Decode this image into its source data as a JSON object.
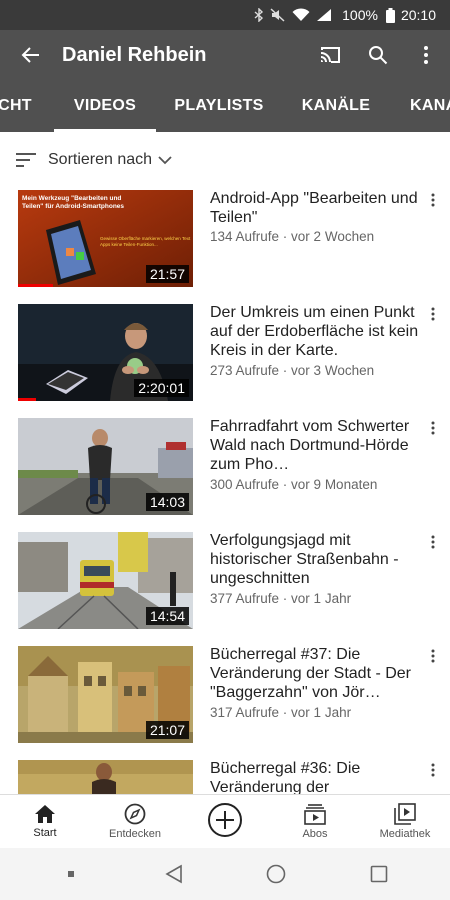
{
  "status_bar": {
    "battery_percent": "100%",
    "time": "20:10"
  },
  "header": {
    "title": "Daniel Rehbein"
  },
  "tabs": [
    {
      "label": "CHT",
      "active": false
    },
    {
      "label": "VIDEOS",
      "active": true
    },
    {
      "label": "PLAYLISTS",
      "active": false
    },
    {
      "label": "KANÄLE",
      "active": false
    },
    {
      "label": "KANA",
      "active": false
    }
  ],
  "sort": {
    "label": "Sortieren nach"
  },
  "videos": [
    {
      "title": "Android-App \"Bearbeiten und Teilen\"",
      "meta": "134 Aufrufe · vor 2 Wochen",
      "duration": "21:57",
      "watched_fraction": 0.2,
      "thumb_text": {
        "line1": "Mein Werkzeug \"Bearbeiten und",
        "line2": "Teilen\" für Android-Smartphones",
        "line3": "Gewisse Oberfläche markieren, welchen Text",
        "line4": "Apps keine Teilen-Funktion..."
      }
    },
    {
      "title": "Der Umkreis um einen Punkt auf der Erdoberfläche ist kein Kreis in der Karte.",
      "meta": "273 Aufrufe · vor 3 Wochen",
      "duration": "2:20:01",
      "watched_fraction": 0.1
    },
    {
      "title": "Fahrradfahrt vom Schwerter Wald nach Dortmund-Hörde zum Pho…",
      "meta": "300 Aufrufe · vor 9 Monaten",
      "duration": "14:03",
      "watched_fraction": 0
    },
    {
      "title": "Verfolgungsjagd mit historischer Straßenbahn - ungeschnitten",
      "meta": "377 Aufrufe · vor 1 Jahr",
      "duration": "14:54",
      "watched_fraction": 0
    },
    {
      "title": "Bücherregal #37: Die Veränderung der Stadt - Der \"Baggerzahn\" von Jör…",
      "meta": "317 Aufrufe · vor 1 Jahr",
      "duration": "21:07",
      "watched_fraction": 0
    },
    {
      "title": "Bücherregal #36: Die Veränderung der",
      "meta": "",
      "duration": "",
      "watched_fraction": 0
    }
  ],
  "bottom_nav": [
    {
      "label": "Start",
      "icon": "home-icon",
      "active": true
    },
    {
      "label": "Entdecken",
      "icon": "compass-icon",
      "active": false
    },
    {
      "label": "",
      "icon": "add-icon",
      "active": false
    },
    {
      "label": "Abos",
      "icon": "subscriptions-icon",
      "active": false
    },
    {
      "label": "Mediathek",
      "icon": "library-icon",
      "active": false
    }
  ],
  "colors": {
    "header_bg": "#505050",
    "status_bg": "#3a3a3a",
    "progress": "#e00000"
  }
}
